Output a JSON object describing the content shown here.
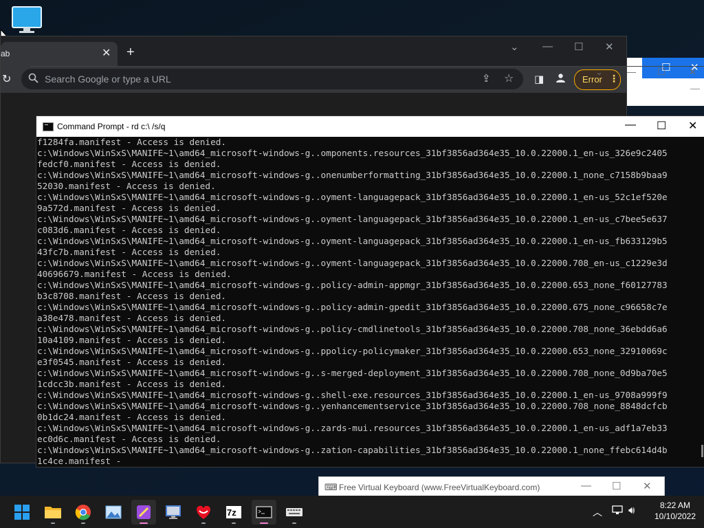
{
  "chrome": {
    "tab_title": "ab",
    "omnibox_placeholder": "Search Google or type a URL",
    "error_label": "Error"
  },
  "cmd": {
    "title": "Command Prompt - rd  c:\\ /s/q",
    "lines": [
      "f1284fa.manifest - Access is denied.",
      "c:\\Windows\\WinSxS\\MANIFE~1\\amd64_microsoft-windows-g..omponents.resources_31bf3856ad364e35_10.0.22000.1_en-us_326e9c2405",
      "fedcf0.manifest - Access is denied.",
      "c:\\Windows\\WinSxS\\MANIFE~1\\amd64_microsoft-windows-g..onenumberformatting_31bf3856ad364e35_10.0.22000.1_none_c7158b9baa9",
      "52030.manifest - Access is denied.",
      "c:\\Windows\\WinSxS\\MANIFE~1\\amd64_microsoft-windows-g..oyment-languagepack_31bf3856ad364e35_10.0.22000.1_en-us_52c1ef520e",
      "9a572d.manifest - Access is denied.",
      "c:\\Windows\\WinSxS\\MANIFE~1\\amd64_microsoft-windows-g..oyment-languagepack_31bf3856ad364e35_10.0.22000.1_en-us_c7bee5e637",
      "c083d6.manifest - Access is denied.",
      "c:\\Windows\\WinSxS\\MANIFE~1\\amd64_microsoft-windows-g..oyment-languagepack_31bf3856ad364e35_10.0.22000.1_en-us_fb633129b5",
      "43fc7b.manifest - Access is denied.",
      "c:\\Windows\\WinSxS\\MANIFE~1\\amd64_microsoft-windows-g..oyment-languagepack_31bf3856ad364e35_10.0.22000.708_en-us_c1229e3d",
      "40696679.manifest - Access is denied.",
      "c:\\Windows\\WinSxS\\MANIFE~1\\amd64_microsoft-windows-g..policy-admin-appmgr_31bf3856ad364e35_10.0.22000.653_none_f60127783",
      "b3c8708.manifest - Access is denied.",
      "c:\\Windows\\WinSxS\\MANIFE~1\\amd64_microsoft-windows-g..policy-admin-gpedit_31bf3856ad364e35_10.0.22000.675_none_c96658c7e",
      "a38e478.manifest - Access is denied.",
      "c:\\Windows\\WinSxS\\MANIFE~1\\amd64_microsoft-windows-g..policy-cmdlinetools_31bf3856ad364e35_10.0.22000.708_none_36ebdd6a6",
      "10a4109.manifest - Access is denied.",
      "c:\\Windows\\WinSxS\\MANIFE~1\\amd64_microsoft-windows-g..ppolicy-policymaker_31bf3856ad364e35_10.0.22000.653_none_32910069c",
      "e3f0545.manifest - Access is denied.",
      "c:\\Windows\\WinSxS\\MANIFE~1\\amd64_microsoft-windows-g..s-merged-deployment_31bf3856ad364e35_10.0.22000.708_none_0d9ba70e5",
      "1cdcc3b.manifest - Access is denied.",
      "c:\\Windows\\WinSxS\\MANIFE~1\\amd64_microsoft-windows-g..shell-exe.resources_31bf3856ad364e35_10.0.22000.1_en-us_9708a999f9",
      "c:\\Windows\\WinSxS\\MANIFE~1\\amd64_microsoft-windows-g..yenhancementservice_31bf3856ad364e35_10.0.22000.708_none_8848dcfcb",
      "0b1dc24.manifest - Access is denied.",
      "c:\\Windows\\WinSxS\\MANIFE~1\\amd64_microsoft-windows-g..zards-mui.resources_31bf3856ad364e35_10.0.22000.1_en-us_adf1a7eb33",
      "ec0d6c.manifest - Access is denied.",
      "c:\\Windows\\WinSxS\\MANIFE~1\\amd64_microsoft-windows-g..zation-capabilities_31bf3856ad364e35_10.0.22000.1_none_ffebc614d4b",
      "1c4ce.manifest -"
    ]
  },
  "vkb": {
    "title": "Free Virtual Keyboard (www.FreeVirtualKeyboard.com)"
  },
  "taskbar": {
    "apps": [
      {
        "name": "start-button",
        "icon": "windows-logo-icon",
        "color": "#2aa0f0"
      },
      {
        "name": "file-explorer-taskbar-button",
        "icon": "folder-icon",
        "color": "#f3b62b"
      },
      {
        "name": "chrome-taskbar-button",
        "icon": "chrome-icon",
        "color": "#34a853"
      },
      {
        "name": "photos-taskbar-button",
        "icon": "photo-icon",
        "color": "#6aa7e0"
      },
      {
        "name": "app-taskbar-button",
        "icon": "purple-app-icon",
        "color": "#9b4de0"
      },
      {
        "name": "remote-desktop-taskbar-button",
        "icon": "monitor-icon",
        "color": "#4a7fd4"
      },
      {
        "name": "red-app-taskbar-button",
        "icon": "red-app-icon",
        "color": "#e81123"
      },
      {
        "name": "7zip-taskbar-button",
        "icon": "7zip-icon",
        "color": "#ffffff"
      },
      {
        "name": "command-prompt-taskbar-button",
        "icon": "terminal-icon",
        "color": "#cccccc"
      },
      {
        "name": "keyboard-taskbar-button",
        "icon": "keyboard-icon",
        "color": "#dddddd"
      }
    ],
    "sevenzip_text": "7z",
    "time": "8:22 AM",
    "date": "10/10/2022"
  }
}
